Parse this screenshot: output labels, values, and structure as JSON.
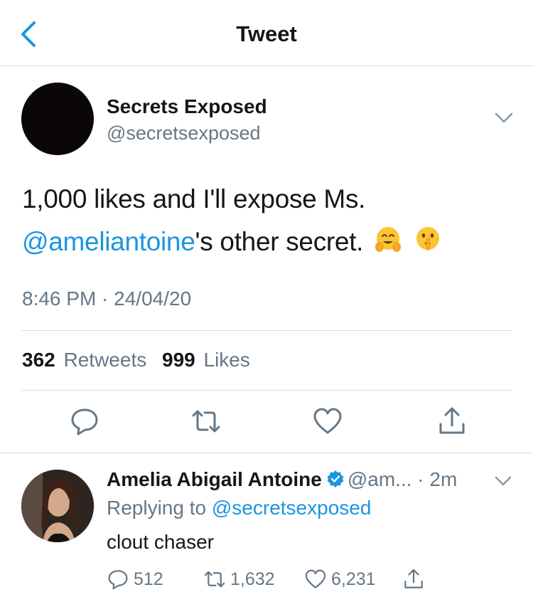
{
  "header": {
    "title": "Tweet"
  },
  "tweet": {
    "name": "Secrets Exposed",
    "handle": "@secretsexposed",
    "text_before": "1,000 likes and I'll expose Ms.",
    "mention": "@ameliantoine",
    "text_after": "'s other secret.",
    "emojis": [
      "hugging-face",
      "shushing-face"
    ],
    "timestamp": "8:46 PM · 24/04/20",
    "retweets_count": "362",
    "retweets_label": "Retweets",
    "likes_count": "999",
    "likes_label": "Likes"
  },
  "reply": {
    "name": "Amelia Abigail Antoine",
    "verified": true,
    "handle_time": "@am... · 2m",
    "replying_prefix": "Replying to",
    "replying_to": "@secretsexposed",
    "text": "clout chaser",
    "reply_count": "512",
    "retweet_count": "1,632",
    "like_count": "6,231"
  },
  "colors": {
    "accent": "#1b95e0",
    "muted": "#657786",
    "text": "#14171a",
    "divider": "#d8dcdf"
  }
}
